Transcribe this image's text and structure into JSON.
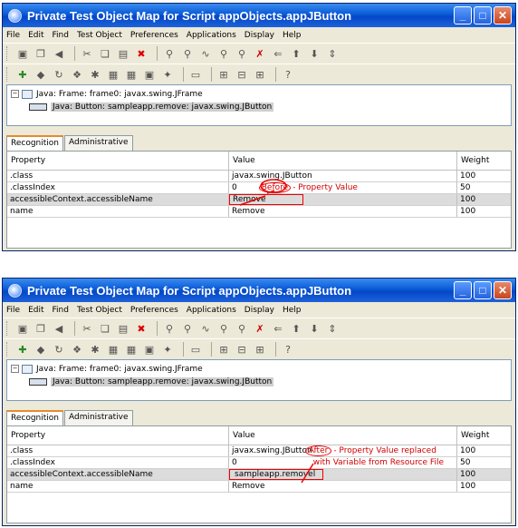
{
  "windows": [
    {
      "title": "Private Test Object Map for Script appObjects.appJButton",
      "menu": [
        "File",
        "Edit",
        "Find",
        "Test Object",
        "Preferences",
        "Applications",
        "Display",
        "Help"
      ],
      "tree": {
        "root": "Java: Frame: frame0: javax.swing.JFrame",
        "child": "Java: Button: sampleapp.remove: javax.swing.JButton"
      },
      "tabs": [
        "Recognition",
        "Administrative"
      ],
      "columns": [
        "Property",
        "Value",
        "Weight"
      ],
      "rows": [
        {
          "property": ".class",
          "value": "javax.swing.JButton",
          "weight": "100"
        },
        {
          "property": ".classIndex",
          "value": "0",
          "weight": "50"
        },
        {
          "property": "accessibleContext.accessibleName",
          "value": "Remove",
          "weight": "100"
        },
        {
          "property": "name",
          "value": "Remove",
          "weight": "100"
        }
      ],
      "annotation": {
        "circled": "Before",
        "text": "- Property Value"
      }
    },
    {
      "title": "Private Test Object Map for Script appObjects.appJButton",
      "menu": [
        "File",
        "Edit",
        "Find",
        "Test Object",
        "Preferences",
        "Applications",
        "Display",
        "Help"
      ],
      "tree": {
        "root": "Java: Frame: frame0: javax.swing.JFrame",
        "child": "Java: Button: sampleapp.remove: javax.swing.JButton"
      },
      "tabs": [
        "Recognition",
        "Administrative"
      ],
      "columns": [
        "Property",
        "Value",
        "Weight"
      ],
      "rows": [
        {
          "property": ".class",
          "value": "javax.swing.JButton",
          "weight": "100"
        },
        {
          "property": ".classIndex",
          "value": "0",
          "weight": "50"
        },
        {
          "property": "accessibleContext.accessibleName",
          "value": "sampleapp.removel",
          "weight": "100"
        },
        {
          "property": "name",
          "value": "Remove",
          "weight": "100"
        }
      ],
      "annotation": {
        "circled": "After",
        "text": "- Property Value replaced",
        "text2": "with Variable from Resource File"
      }
    }
  ],
  "window_controls": {
    "minimize": "_",
    "maximize": "□",
    "close": "✕"
  },
  "colors": {
    "titlebar": "#0a5ad6",
    "annotation": "#e00000",
    "highlight_row": "#dcdcdc"
  }
}
